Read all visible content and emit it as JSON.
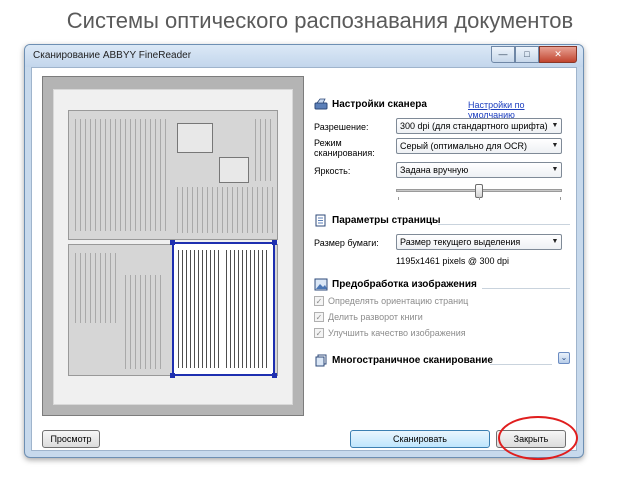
{
  "slide": {
    "title": "Системы оптического распознавания документов"
  },
  "window": {
    "title": "Сканирование ABBYY FineReader",
    "buttons": {
      "minimize": "—",
      "maximize": "□",
      "close": "✕"
    }
  },
  "scanner_settings": {
    "header": "Настройки сканера",
    "defaults_link": "Настройки по умолчанию",
    "resolution_label": "Разрешение:",
    "resolution_value": "300 dpi (для стандартного шрифта)",
    "mode_label_line1": "Режим",
    "mode_label_line2": "сканирования:",
    "mode_value": "Серый (оптимально для OCR)",
    "brightness_label": "Яркость:",
    "brightness_value": "Задана вручную",
    "brightness_level_fraction": 0.5
  },
  "page_params": {
    "header": "Параметры страницы",
    "paper_size_label": "Размер бумаги:",
    "paper_size_value": "Размер текущего выделения",
    "size_info": "1195x1461 pixels @ 300 dpi"
  },
  "preprocessing": {
    "header": "Предобработка изображения",
    "options": [
      {
        "label": "Определять ориентацию страниц",
        "checked": true
      },
      {
        "label": "Делить разворот книги",
        "checked": true
      },
      {
        "label": "Улучшить качество изображения",
        "checked": true
      }
    ]
  },
  "multipage": {
    "header": "Многостраничное сканирование"
  },
  "footer": {
    "preview_label": "Просмотр",
    "scan_label": "Сканировать",
    "close_label": "Закрыть"
  },
  "colors": {
    "link": "#1d3fbf",
    "selection": "#1e2fb0",
    "highlight": "#e01e1e"
  }
}
